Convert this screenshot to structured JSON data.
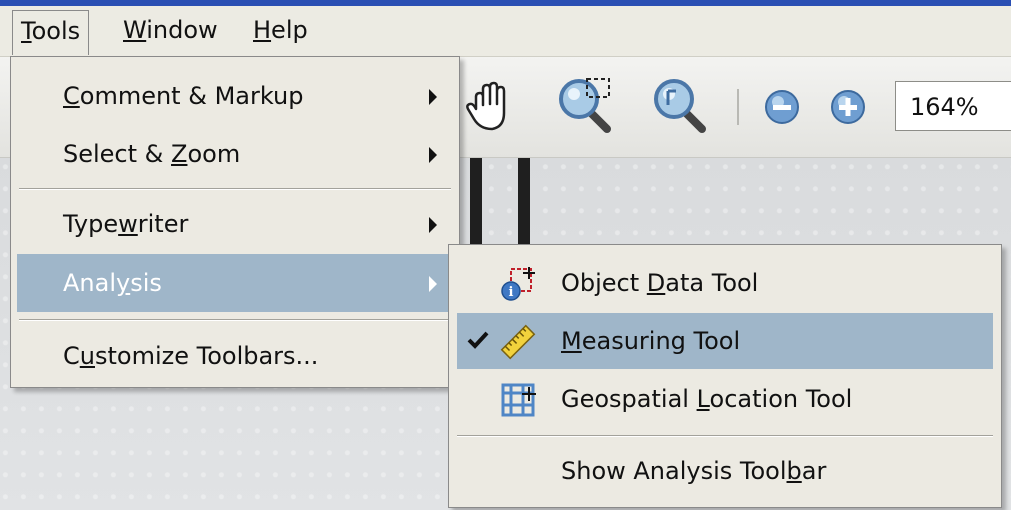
{
  "menubar": {
    "tools": {
      "pre": "",
      "key": "T",
      "post": "ools"
    },
    "window": {
      "pre": "",
      "key": "W",
      "post": "indow"
    },
    "help": {
      "pre": "",
      "key": "H",
      "post": "elp"
    }
  },
  "toolbar": {
    "zoom_value": "164%",
    "icons": [
      "hand-icon",
      "zoom-marquee-icon",
      "zoom-dynamic-icon",
      "zoom-out-icon",
      "zoom-in-icon"
    ]
  },
  "tools_menu": {
    "items": [
      {
        "pre": "",
        "key": "C",
        "post": "omment & Markup",
        "has_submenu": true
      },
      {
        "pre": "Select & ",
        "key": "Z",
        "post": "oom",
        "has_submenu": true
      },
      {
        "pre": "Type",
        "key": "w",
        "post": "riter",
        "has_submenu": true
      },
      {
        "pre": "Anal",
        "key": "y",
        "post": "sis",
        "has_submenu": true,
        "highlighted": true
      },
      {
        "pre": "C",
        "key": "u",
        "post": "stomize Toolbars...",
        "has_submenu": false
      }
    ]
  },
  "analysis_menu": {
    "items": [
      {
        "pre": "Object ",
        "key": "D",
        "post": "ata Tool",
        "icon": "object-data-icon"
      },
      {
        "pre": "",
        "key": "M",
        "post": "easuring Tool",
        "icon": "ruler-icon",
        "checked": true,
        "highlighted": true
      },
      {
        "pre": "Geospatial ",
        "key": "L",
        "post": "ocation Tool",
        "icon": "geospatial-grid-icon"
      },
      {
        "pre": "Show Analysis Tool",
        "key": "b",
        "post": "ar",
        "icon": ""
      }
    ]
  },
  "colors": {
    "highlight": "#9fb6c9",
    "menu_bg": "#eceae2",
    "titlebar": "#2a4fb3"
  }
}
